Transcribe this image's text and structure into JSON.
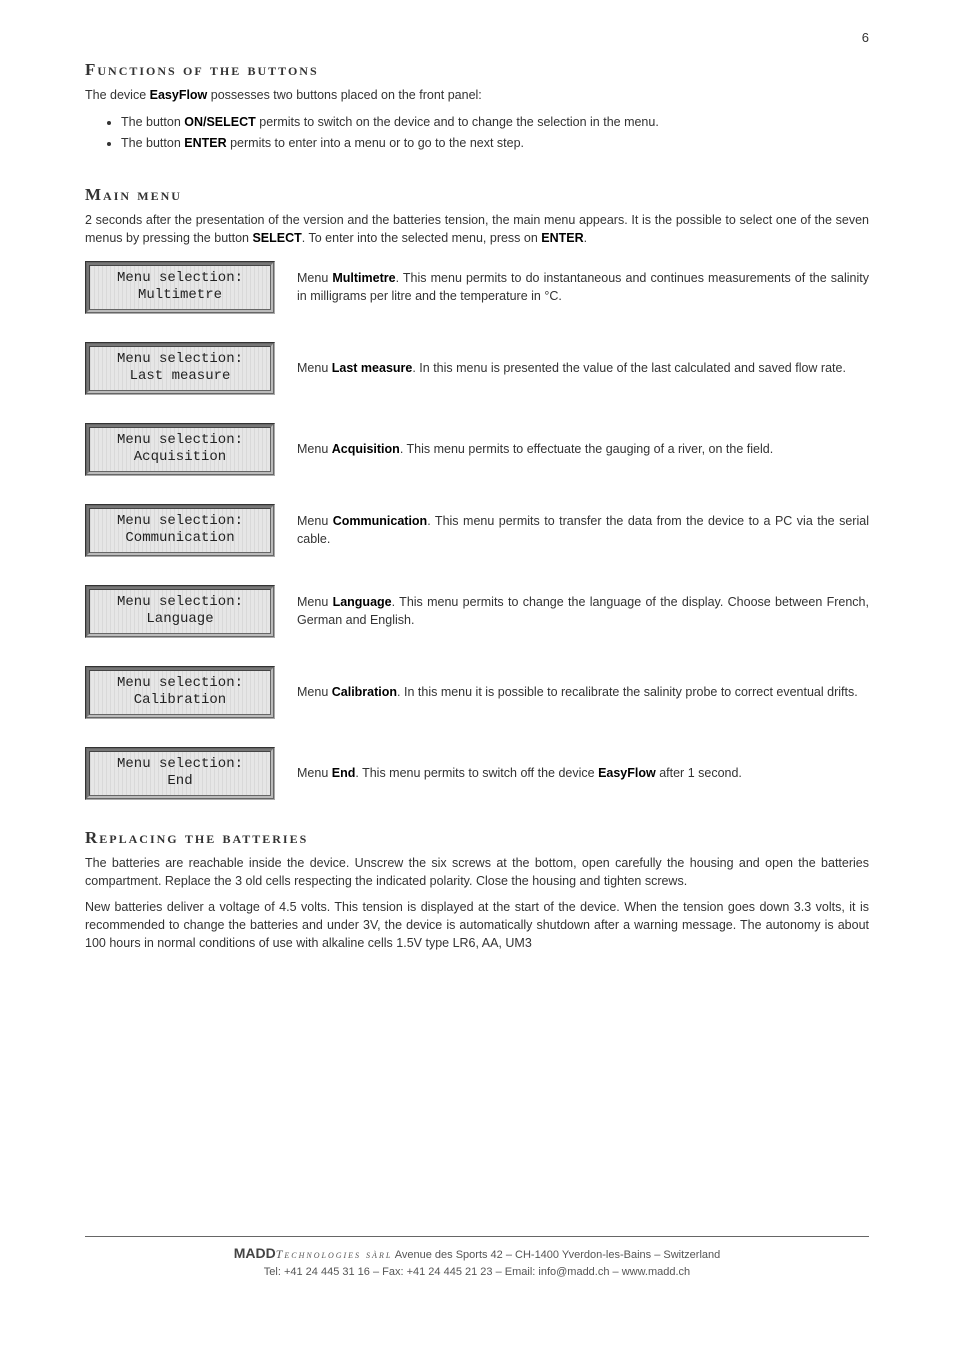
{
  "page_number": "6",
  "sections": {
    "functions": {
      "heading": "Functions of the buttons",
      "intro_pre": "The device ",
      "intro_bold": "EasyFlow",
      "intro_post": " possesses two buttons placed on the front panel:",
      "b1_pre": "The button ",
      "b1_bold": "ON/SELECT",
      "b1_post": " permits to switch on the device and to change the selection in the menu.",
      "b2_pre": "The button ",
      "b2_bold": "ENTER",
      "b2_post": " permits to enter into a menu or to go to the next step."
    },
    "main_menu": {
      "heading": "Main menu",
      "p_pre": "2 seconds after the presentation of the version and the batteries tension, the main menu appears. It is the possible to select one of the seven menus by pressing the button ",
      "p_b1": "SELECT",
      "p_mid": ". To enter into the selected menu, press on ",
      "p_b2": "ENTER",
      "p_post": "."
    },
    "batteries": {
      "heading": "Replacing the batteries",
      "p1": "The batteries are reachable inside the device. Unscrew the six screws at the bottom, open carefully the housing and open the batteries compartment. Replace the 3 old cells respecting the indicated polarity. Close the housing and tighten screws.",
      "p2": "New batteries deliver a voltage of 4.5 volts. This tension is displayed at the start of the device. When the tension goes down 3.3 volts, it is recommended to change the batteries and under 3V, the device is automatically shutdown after a warning message. The autonomy is about 100 hours in normal conditions of use with alkaline cells 1.5V type LR6, AA, UM3"
    }
  },
  "menus": [
    {
      "lcd1": "Menu selection:",
      "lcd2": "Multimetre",
      "d_pre": "Menu ",
      "d_bold": "Multimetre",
      "d_post": ". This menu permits to do instantaneous and continues measurements of the salinity in milligrams per litre and the temperature in °C."
    },
    {
      "lcd1": "Menu selection:",
      "lcd2": "Last measure",
      "d_pre": "Menu ",
      "d_bold": "Last measure",
      "d_post": ". In this menu is presented the value of the last calculated and saved flow rate."
    },
    {
      "lcd1": "Menu selection:",
      "lcd2": "Acquisition",
      "d_pre": "Menu ",
      "d_bold": "Acquisition",
      "d_post": ". This menu permits to effectuate the gauging of a river, on the field."
    },
    {
      "lcd1": "Menu selection:",
      "lcd2": "Communication",
      "d_pre": "Menu ",
      "d_bold": "Communication",
      "d_post": ". This menu permits to transfer the data from the device to a PC via the serial cable."
    },
    {
      "lcd1": "Menu selection:",
      "lcd2": "Language",
      "d_pre": "Menu ",
      "d_bold": "Language",
      "d_post": ". This menu permits to change the language of the display. Choose between French, German and English."
    },
    {
      "lcd1": "Menu selection:",
      "lcd2": "Calibration",
      "d_pre": "Menu ",
      "d_bold": "Calibration",
      "d_post": ". In this menu it is possible to recalibrate the salinity probe to correct eventual drifts."
    },
    {
      "lcd1": "Menu selection:",
      "lcd2": "End",
      "d_pre": "Menu ",
      "d_bold": "End",
      "d_mid": ". This menu permits to switch off the device ",
      "d_bold2": "EasyFlow",
      "d_post": " after 1 second."
    }
  ],
  "footer": {
    "brand": "MADD",
    "tech": "Technologies sàrl",
    "addr": "  Avenue des Sports 42 – CH-1400 Yverdon-les-Bains – Switzerland",
    "line2": "Tel: +41 24 445 31 16 – Fax: +41 24 445 21 23 – Email: info@madd.ch – www.madd.ch"
  }
}
